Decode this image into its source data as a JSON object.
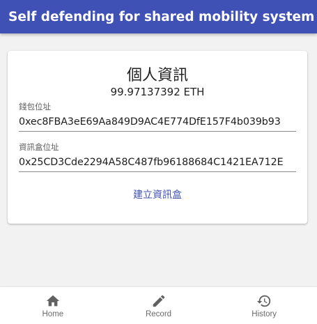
{
  "app_bar": {
    "title": "Self defending for shared mobility system"
  },
  "profile": {
    "title": "個人資訊",
    "balance": "99.97137392 ETH",
    "wallet": {
      "label": "錢包位址",
      "value": "0xec8FBA3eE69Aa849D9AC4E774DfE157F4b039b93"
    },
    "infobox": {
      "label": "資訊盒位址",
      "value": "0x25CD3Cde2294A58C487fb96188684C1421EA712E"
    },
    "create_button_label": "建立資訊盒"
  },
  "bottom_nav": {
    "items": [
      {
        "label": "Home",
        "icon": "home-icon"
      },
      {
        "label": "Record",
        "icon": "pencil-icon"
      },
      {
        "label": "History",
        "icon": "history-icon"
      }
    ]
  },
  "colors": {
    "primary": "#3f51b5",
    "background": "#f3f2f2",
    "nav_icon": "#616161"
  }
}
